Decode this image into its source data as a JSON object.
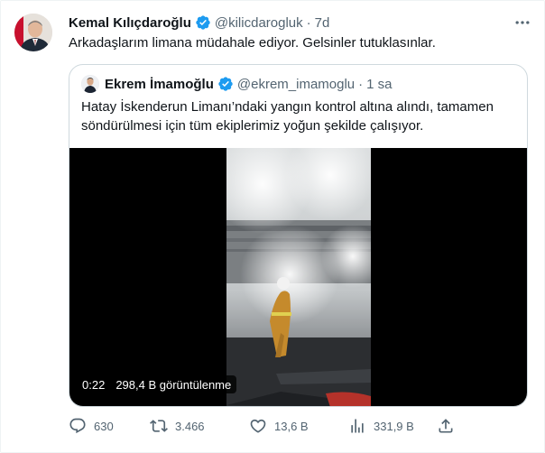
{
  "tweet": {
    "author_name": "Kemal Kılıçdaroğlu",
    "author_handle": "@kilicdarogluk",
    "separator": "·",
    "time": "7d",
    "text": "Arkadaşlarım limana müdahale ediyor. Gelsinler tutuklasınlar."
  },
  "quote": {
    "author_name": "Ekrem İmamoğlu",
    "author_handle": "@ekrem_imamoglu",
    "separator": "·",
    "time": "1 sa",
    "text": "Hatay İskenderun Limanı’ndaki yangın kontrol altına alındı, tamamen söndürülmesi için tüm ekiplerimiz yoğun şekilde çalışıyor.",
    "video": {
      "duration": "0:22",
      "views": "298,4 B görüntülenme"
    }
  },
  "actions": {
    "reply_count": "630",
    "retweet_count": "3.466",
    "like_count": "13,6 B",
    "views_count": "331,9 B"
  },
  "colors": {
    "verified": "#1d9bf0",
    "secondary_text": "#536471",
    "border": "#cfd9de"
  },
  "icons": [
    "verified-badge-icon",
    "more-icon",
    "reply-icon",
    "retweet-icon",
    "like-icon",
    "views-icon",
    "share-icon"
  ]
}
